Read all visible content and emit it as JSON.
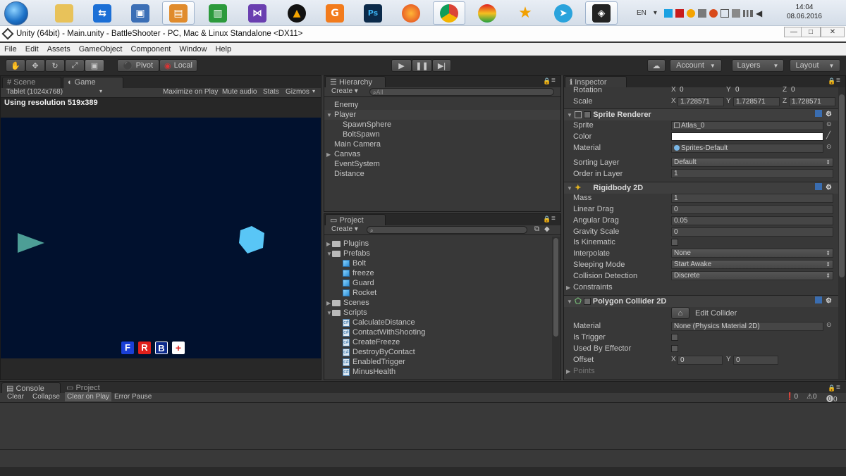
{
  "taskbar": {
    "tray_lang": "EN",
    "clock_time": "14:04",
    "clock_date": "08.06.2016",
    "apps": [
      "Explorer",
      "TeamViewer",
      "VirtualBox",
      "Remote Desktop",
      "Graph",
      "Visual Studio",
      "VLC",
      "Foxit PDF",
      "Photoshop",
      "Firefox",
      "Chrome",
      "Opera",
      "Pin",
      "Telegram",
      "Unity"
    ]
  },
  "window": {
    "title": "Unity (64bit) - Main.unity - BattleShooter - PC, Mac & Linux Standalone <DX11>",
    "min": "—",
    "max": "□",
    "close": "✕"
  },
  "menu": [
    "File",
    "Edit",
    "Assets",
    "GameObject",
    "Component",
    "Window",
    "Help"
  ],
  "toolbar": {
    "pivot": "Pivot",
    "local": "Local",
    "account": "Account",
    "layers": "Layers",
    "layout": "Layout"
  },
  "game": {
    "tab_scene": "Scene",
    "tab_game": "Game",
    "resolution_select": "Tablet (1024x768)",
    "maximize": "Maximize on Play",
    "mute": "Mute audio",
    "stats": "Stats",
    "gizmos": "Gizmos",
    "resolution_text": "Using resolution 519x389",
    "buttons": [
      "F",
      "R",
      "B",
      "+"
    ],
    "button_colors": [
      "#1a3fd6",
      "#e0201c",
      "#0c2a8c",
      "#ffffff"
    ],
    "bg_color": "#01112e"
  },
  "hierarchy": {
    "tab": "Hierarchy",
    "create": "Create",
    "search": "All",
    "items": [
      "Enemy",
      "Player",
      "SpawnSphere",
      "BoltSpawn",
      "Main Camera",
      "Canvas",
      "EventSystem",
      "Distance"
    ]
  },
  "project": {
    "tab": "Project",
    "create": "Create",
    "folders": [
      {
        "label": "Plugins",
        "expanded": false,
        "children": []
      },
      {
        "label": "Prefabs",
        "expanded": true,
        "children": [
          "Bolt",
          "freeze",
          "Guard",
          "Rocket"
        ]
      },
      {
        "label": "Scenes",
        "expanded": false,
        "children": []
      },
      {
        "label": "Scripts",
        "expanded": true,
        "children": [
          "CalculateDistance",
          "ContactWithShooting",
          "CreateFreeze",
          "DestroyByContact",
          "EnabledTrigger",
          "MinusHealth"
        ]
      }
    ]
  },
  "inspector": {
    "tab": "Inspector",
    "transform": {
      "rotation_label": "Rotation",
      "rotation": [
        "0",
        "0",
        "0"
      ],
      "scale_label": "Scale",
      "scale": [
        "1.728571",
        "1.728571",
        "1.728571"
      ]
    },
    "sprite_renderer": {
      "title": "Sprite Renderer",
      "sprite_label": "Sprite",
      "sprite": "Atlas_0",
      "color_label": "Color",
      "material_label": "Material",
      "material": "Sprites-Default",
      "sorting_label": "Sorting Layer",
      "sorting": "Default",
      "order_label": "Order in Layer",
      "order": "1"
    },
    "rigidbody": {
      "title": "Rigidbody 2D",
      "mass_label": "Mass",
      "mass": "1",
      "linear_label": "Linear Drag",
      "linear": "0",
      "angular_label": "Angular Drag",
      "angular": "0.05",
      "gravity_label": "Gravity Scale",
      "gravity": "0",
      "kinematic_label": "Is Kinematic",
      "interpolate_label": "Interpolate",
      "interpolate": "None",
      "sleeping_label": "Sleeping Mode",
      "sleeping": "Start Awake",
      "collision_label": "Collision Detection",
      "collision": "Discrete",
      "constraints_label": "Constraints"
    },
    "polygon": {
      "title": "Polygon Collider 2D",
      "edit": "Edit Collider",
      "material_label": "Material",
      "material": "None (Physics Material 2D)",
      "trigger_label": "Is Trigger",
      "effector_label": "Used By Effector",
      "offset_label": "Offset",
      "offset": [
        "0",
        "0"
      ],
      "points_label": "Points"
    }
  },
  "console": {
    "tab_console": "Console",
    "tab_project": "Project",
    "clear": "Clear",
    "collapse": "Collapse",
    "clear_on_play": "Clear on Play",
    "error_pause": "Error Pause",
    "counts": [
      "0",
      "0",
      "0"
    ]
  }
}
